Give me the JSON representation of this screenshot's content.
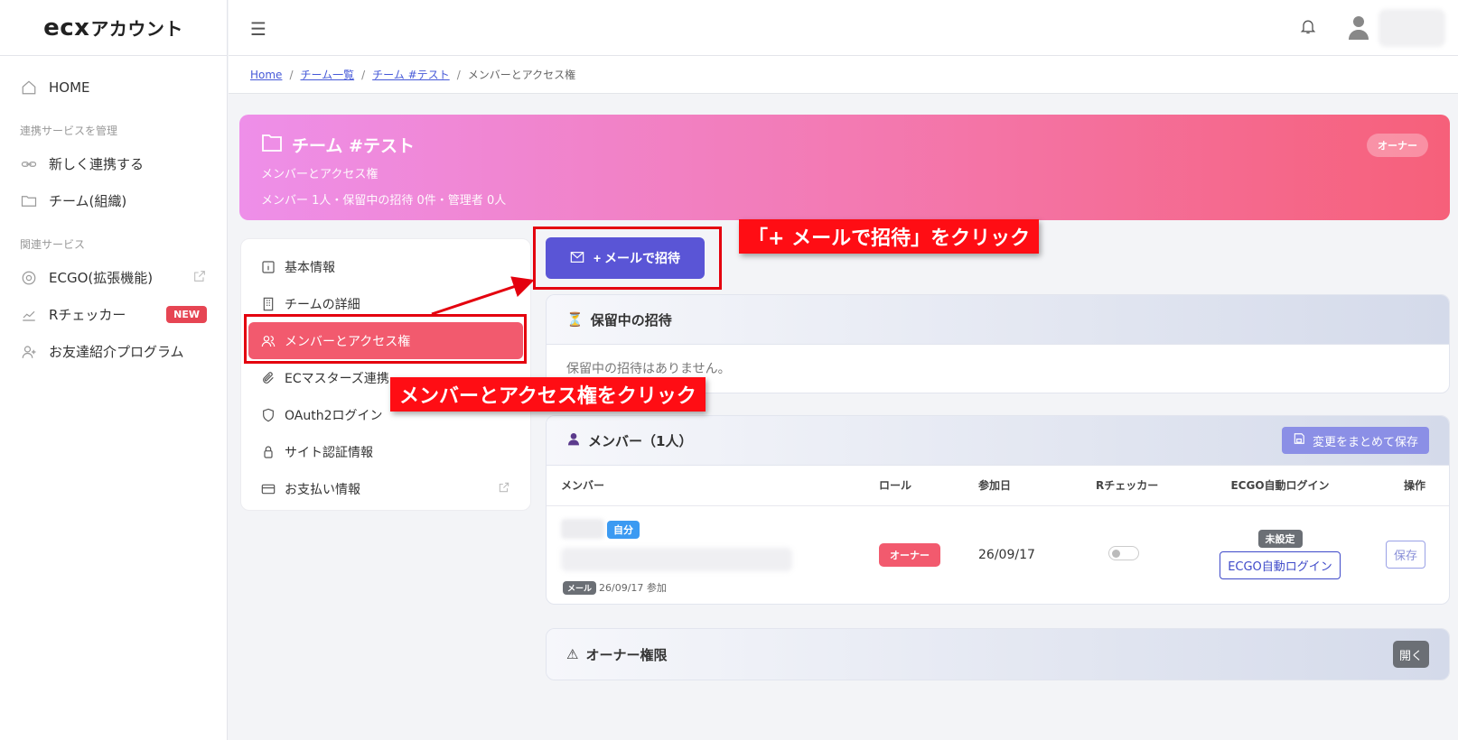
{
  "app": {
    "logo_ecx": "ecx",
    "logo_rest": "アカウント"
  },
  "sidebar": {
    "home": "HOME",
    "section_manage": "連携サービスを管理",
    "new_link": "新しく連携する",
    "team": "チーム(組織)",
    "section_related": "関連サービス",
    "ecgo": "ECGO(拡張機能)",
    "rchecker": "Rチェッカー",
    "new_badge": "NEW",
    "referral": "お友達紹介プログラム"
  },
  "breadcrumb": {
    "home": "Home",
    "team_list": "チーム一覧",
    "team": "チーム #テスト",
    "current": "メンバーとアクセス権"
  },
  "hero": {
    "title": "チーム #テスト",
    "subtitle": "メンバーとアクセス権",
    "meta": "メンバー 1人・保留中の招待 0件・管理者 0人",
    "owner_pill": "オーナー"
  },
  "menu": {
    "basic": "基本情報",
    "detail": "チームの詳細",
    "members": "メンバーとアクセス権",
    "ecmasters": "ECマスターズ連携",
    "oauth": "OAuth2ログイン",
    "site_auth": "サイト認証情報",
    "payment": "お支払い情報"
  },
  "invite": {
    "label": "+ メールで招待"
  },
  "pending": {
    "title": "保留中の招待",
    "empty": "保留中の招待はありません。"
  },
  "members": {
    "title": "メンバー（1人）",
    "save_all": "変更をまとめて保存",
    "headers": {
      "member": "メンバー",
      "role": "ロール",
      "joined": "参加日",
      "rchecker": "Rチェッカー",
      "ecgo": "ECGO自動ログイン",
      "op": "操作"
    },
    "row": {
      "self_badge": "自分",
      "mail_badge": "メール",
      "joined_sub": "26/09/17 参加",
      "role": "オーナー",
      "joined": "26/09/17",
      "ecgo_status": "未設定",
      "ecgo_button": "ECGO自動ログイン",
      "op_button": "保存"
    }
  },
  "owner_perm": {
    "title": "オーナー権限",
    "open": "開く"
  },
  "annotations": {
    "invite_callout": "「+ メールで招待」をクリック",
    "members_callout": "メンバーとアクセス権をクリック"
  },
  "colors": {
    "accent": "#5a55d6",
    "active": "#f25a6e",
    "annotation": "#ff0d14"
  }
}
